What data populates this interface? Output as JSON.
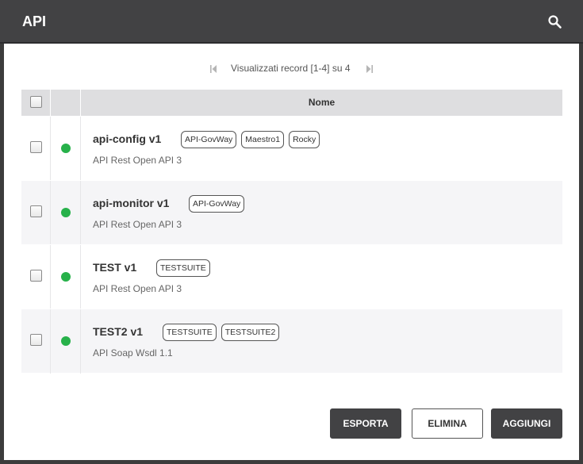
{
  "header": {
    "title": "API",
    "search_icon": "search-icon"
  },
  "pager": {
    "info": "Visualizzati record [1-4] su 4",
    "first_icon": "first-page-icon",
    "last_icon": "last-page-icon"
  },
  "table": {
    "column_header": "Nome",
    "rows": [
      {
        "name": "api-config v1",
        "description": "API Rest Open API 3",
        "status_color": "#27b14a",
        "tags": [
          "API-GovWay",
          "Maestro1",
          "Rocky"
        ]
      },
      {
        "name": "api-monitor v1",
        "description": "API Rest Open API 3",
        "status_color": "#27b14a",
        "tags": [
          "API-GovWay"
        ]
      },
      {
        "name": "TEST v1",
        "description": "API Rest Open API 3",
        "status_color": "#27b14a",
        "tags": [
          "TESTSUITE"
        ]
      },
      {
        "name": "TEST2 v1",
        "description": "API Soap Wsdl 1.1",
        "status_color": "#27b14a",
        "tags": [
          "TESTSUITE",
          "TESTSUITE2"
        ]
      }
    ]
  },
  "actions": {
    "export_label": "ESPORTA",
    "delete_label": "ELIMINA",
    "add_label": "AGGIUNGI"
  },
  "colors": {
    "header_bg": "#424244",
    "status_active": "#27b14a"
  }
}
